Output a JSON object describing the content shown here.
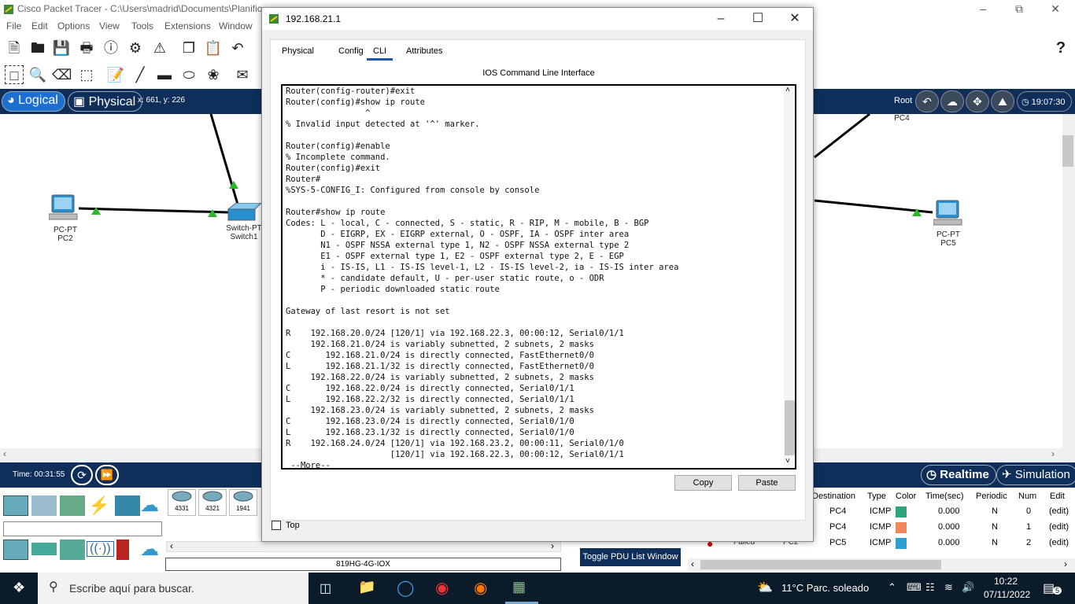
{
  "main_window": {
    "title": "Cisco Packet Tracer - C:\\Users\\madrid\\Documents\\Planific",
    "menu": [
      "File",
      "Edit",
      "Options",
      "View",
      "Tools",
      "Extensions",
      "Window"
    ],
    "help": "?"
  },
  "logical_bar": {
    "logical": "Logical",
    "physical": "Physical",
    "coords": "x: 661, y: 226",
    "root": "Root",
    "time": "19:07:30"
  },
  "workspace": {
    "devices": [
      {
        "type": "PC-PT",
        "name": "PC2"
      },
      {
        "type": "Switch-PT",
        "name": "Switch1"
      },
      {
        "type": "PC-PT",
        "name": "PC5"
      },
      {
        "name": "PC4"
      }
    ]
  },
  "time_bar": {
    "time": "Time: 00:31:55",
    "realtime": "Realtime",
    "simulation": "Simulation"
  },
  "device_panel": {
    "models": [
      "4331",
      "4321",
      "1941"
    ],
    "selected_model": "819HG-4G-IOX",
    "toggle_pdu": "Toggle PDU List Window"
  },
  "pdu_list": {
    "headers": [
      "Destination",
      "Type",
      "Color",
      "Time(sec)",
      "Periodic",
      "Num",
      "Edit"
    ],
    "rows": [
      {
        "destination": "PC4",
        "type": "ICMP",
        "color": "#2fa37a",
        "time": "0.000",
        "periodic": "N",
        "num": "0",
        "edit": "(edit)"
      },
      {
        "destination": "PC4",
        "type": "ICMP",
        "color": "#f0875a",
        "time": "0.000",
        "periodic": "N",
        "num": "1",
        "edit": "(edit)"
      },
      {
        "destination": "PC5",
        "type": "ICMP",
        "color": "#2aa0d0",
        "time": "0.000",
        "periodic": "N",
        "num": "2",
        "edit": "(edit)"
      }
    ],
    "partial_status": "Failed",
    "partial_source": "PC2"
  },
  "dialog": {
    "title": "192.168.21.1",
    "tabs": [
      "Physical",
      "Config",
      "CLI",
      "Attributes"
    ],
    "active_tab": "CLI",
    "cli_title": "IOS Command Line Interface",
    "terminal_text": "Router(config-router)#exit\nRouter(config)#show ip route\n                ^\n% Invalid input detected at '^' marker.\n\nRouter(config)#enable\n% Incomplete command.\nRouter(config)#exit\nRouter#\n%SYS-5-CONFIG_I: Configured from console by console\n\nRouter#show ip route\nCodes: L - local, C - connected, S - static, R - RIP, M - mobile, B - BGP\n       D - EIGRP, EX - EIGRP external, O - OSPF, IA - OSPF inter area\n       N1 - OSPF NSSA external type 1, N2 - OSPF NSSA external type 2\n       E1 - OSPF external type 1, E2 - OSPF external type 2, E - EGP\n       i - IS-IS, L1 - IS-IS level-1, L2 - IS-IS level-2, ia - IS-IS inter area\n       * - candidate default, U - per-user static route, o - ODR\n       P - periodic downloaded static route\n\nGateway of last resort is not set\n\nR    192.168.20.0/24 [120/1] via 192.168.22.3, 00:00:12, Serial0/1/1\n     192.168.21.0/24 is variably subnetted, 2 subnets, 2 masks\nC       192.168.21.0/24 is directly connected, FastEthernet0/0\nL       192.168.21.1/32 is directly connected, FastEthernet0/0\n     192.168.22.0/24 is variably subnetted, 2 subnets, 2 masks\nC       192.168.22.0/24 is directly connected, Serial0/1/1\nL       192.168.22.2/32 is directly connected, Serial0/1/1\n     192.168.23.0/24 is variably subnetted, 2 subnets, 2 masks\nC       192.168.23.0/24 is directly connected, Serial0/1/0\nL       192.168.23.1/32 is directly connected, Serial0/1/0\nR    192.168.24.0/24 [120/1] via 192.168.23.2, 00:00:11, Serial0/1/0\n                     [120/1] via 192.168.22.3, 00:00:12, Serial0/1/1\n --More--",
    "copy": "Copy",
    "paste": "Paste",
    "top_label": "Top"
  },
  "taskbar": {
    "search_placeholder": "Escribe aquí para buscar.",
    "weather": "11°C  Parc. soleado",
    "time": "10:22",
    "date": "07/11/2022",
    "notifications": "5"
  }
}
